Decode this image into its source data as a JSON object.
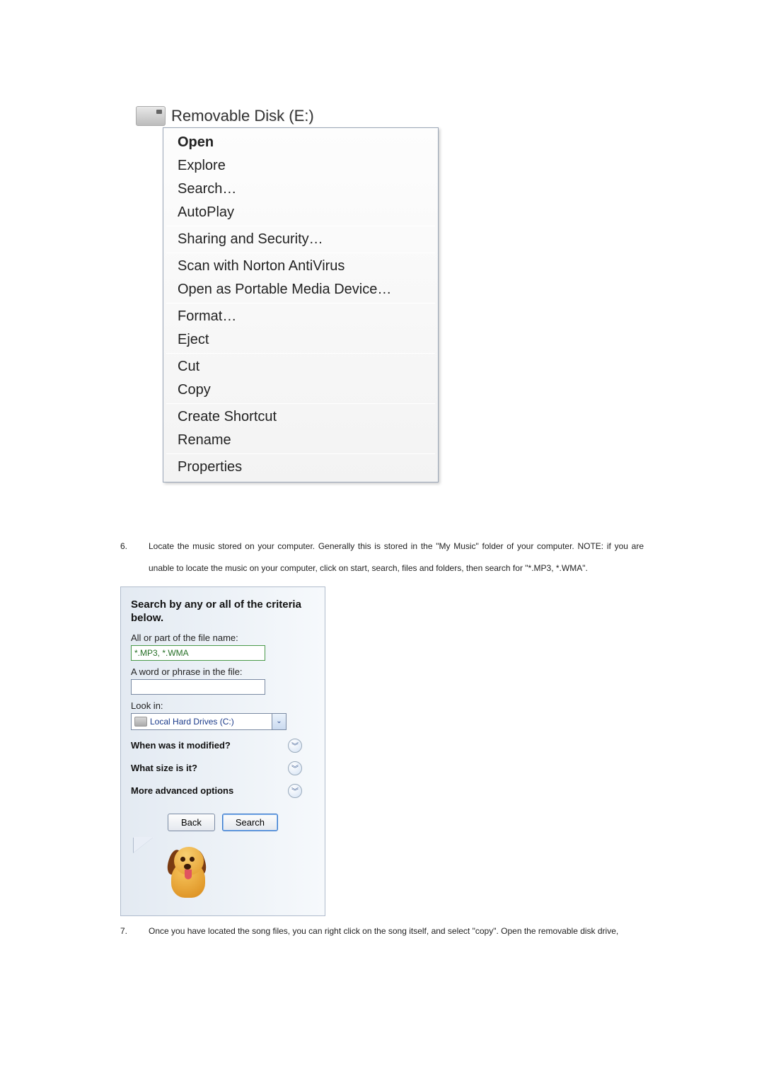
{
  "context_menu": {
    "drive_title": "Removable Disk (E:)",
    "items": [
      {
        "label": "Open",
        "bold": true
      },
      {
        "label": "Explore"
      },
      {
        "label": "Search…"
      },
      {
        "label": "AutoPlay"
      },
      {
        "sep": true
      },
      {
        "label": "Sharing and Security…"
      },
      {
        "sep": true
      },
      {
        "label": "Scan with Norton AntiVirus"
      },
      {
        "label": "Open as Portable Media Device…"
      },
      {
        "sep": true
      },
      {
        "label": "Format…"
      },
      {
        "label": "Eject"
      },
      {
        "sep": true
      },
      {
        "label": "Cut"
      },
      {
        "label": "Copy"
      },
      {
        "sep": true
      },
      {
        "label": "Create Shortcut"
      },
      {
        "label": "Rename"
      },
      {
        "sep": true
      },
      {
        "label": "Properties"
      }
    ]
  },
  "step6": {
    "num": "6.",
    "text": "Locate the music stored on your computer. Generally this is stored in the \"My Music\" folder of your computer. NOTE:  if you are unable to locate the music on your computer, click on start, search, files and folders, then search for \"*.MP3, *.WMA\"."
  },
  "search_panel": {
    "title": "Search by any or all of the criteria below.",
    "filename_label": "All or part of the file name:",
    "filename_value": "*.MP3, *.WMA",
    "phrase_label": "A word or phrase in the file:",
    "phrase_value": "",
    "lookin_label": "Look in:",
    "lookin_value": "Local Hard Drives (C:)",
    "expanders": [
      {
        "label": "When was it modified?"
      },
      {
        "label": "What size is it?"
      },
      {
        "label": "More advanced options"
      }
    ],
    "back_label": "Back",
    "search_label": "Search"
  },
  "step7": {
    "num": "7.",
    "text": "Once you have located the song files, you can right click on the song itself, and select \"copy\".  Open the removable disk drive,"
  }
}
